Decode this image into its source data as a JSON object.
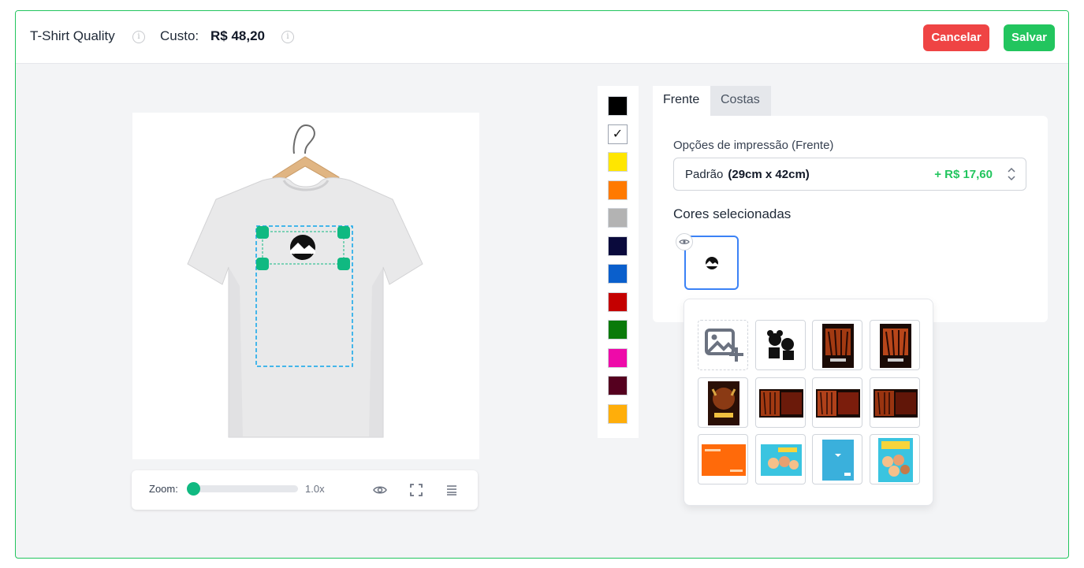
{
  "header": {
    "product_name": "T-Shirt Quality",
    "cost_label": "Custo:",
    "cost_value": "R$ 48,20",
    "cancel_label": "Cancelar",
    "save_label": "Salvar"
  },
  "zoom": {
    "label": "Zoom:",
    "value_text": "1.0x",
    "level": 1.0
  },
  "swatches": [
    {
      "name": "black",
      "color": "#000000"
    },
    {
      "name": "white",
      "color": "#ffffff",
      "selected": true
    },
    {
      "name": "yellow",
      "color": "#ffe600"
    },
    {
      "name": "orange",
      "color": "#ff7a00"
    },
    {
      "name": "gray",
      "color": "#b3b3b3"
    },
    {
      "name": "navy",
      "color": "#0a0a3c"
    },
    {
      "name": "blue",
      "color": "#0a5fcc"
    },
    {
      "name": "red",
      "color": "#c40000"
    },
    {
      "name": "green",
      "color": "#0a7a0a"
    },
    {
      "name": "pink",
      "color": "#ee0aa9"
    },
    {
      "name": "wine",
      "color": "#55001f"
    },
    {
      "name": "amber",
      "color": "#ffae0a"
    }
  ],
  "tabs": {
    "front": "Frente",
    "back": "Costas"
  },
  "print_options": {
    "label": "Opções de impressão (Frente)",
    "selected_name": "Padrão",
    "selected_size": "(29cm x 42cm)",
    "selected_price": "+ R$ 17,60"
  },
  "colors_section": {
    "label": "Cores selecionadas"
  },
  "colors": {
    "accent": "#22c55e",
    "danger": "#ef4444",
    "handle": "#10b981",
    "print_area": "#0ea5e9",
    "selected_border": "#3b82f6"
  },
  "gallery": {
    "items": [
      {
        "kind": "add-image",
        "icon": "add-image-icon"
      },
      {
        "kind": "artwork",
        "name": "mickey-minnie"
      },
      {
        "kind": "artwork",
        "name": "viking-poster-1"
      },
      {
        "kind": "artwork",
        "name": "viking-poster-2"
      },
      {
        "kind": "artwork",
        "name": "viking-poster-3"
      },
      {
        "kind": "artwork",
        "name": "viking-banner-1"
      },
      {
        "kind": "artwork",
        "name": "viking-banner-2"
      },
      {
        "kind": "artwork",
        "name": "viking-banner-3"
      },
      {
        "kind": "artwork",
        "name": "orange-flyer"
      },
      {
        "kind": "artwork",
        "name": "kids-cover-1"
      },
      {
        "kind": "artwork",
        "name": "blue-cover"
      },
      {
        "kind": "artwork",
        "name": "kids-cover-2"
      }
    ]
  }
}
